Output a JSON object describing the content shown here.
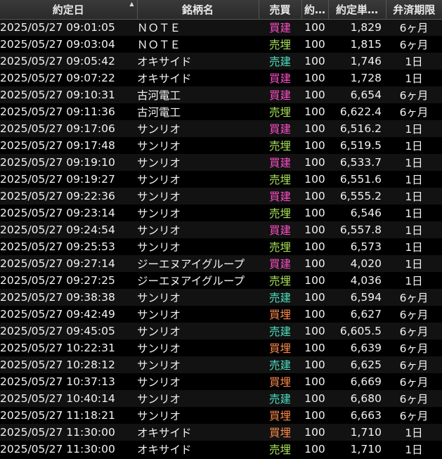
{
  "columns": [
    {
      "label": "約定日",
      "sorted": true
    },
    {
      "label": "銘柄名"
    },
    {
      "label": "売買"
    },
    {
      "label": "約…"
    },
    {
      "label": "約定単…"
    },
    {
      "label": "弁済期限"
    }
  ],
  "side_colors": {
    "買建": "#ff4fc8",
    "売埋": "#a8e05a",
    "売建": "#4fe0c0",
    "買埋": "#ff8a4a"
  },
  "rows": [
    {
      "datetime": "2025/05/27 09:01:05",
      "name": "ＮＯＴＥ",
      "side": "買建",
      "qty": "100",
      "price": "1,829",
      "term": "6ヶ月"
    },
    {
      "datetime": "2025/05/27 09:03:04",
      "name": "ＮＯＴＥ",
      "side": "売埋",
      "qty": "100",
      "price": "1,815",
      "term": "6ヶ月"
    },
    {
      "datetime": "2025/05/27 09:05:42",
      "name": "オキサイド",
      "side": "売建",
      "qty": "100",
      "price": "1,746",
      "term": "1日"
    },
    {
      "datetime": "2025/05/27 09:07:22",
      "name": "オキサイド",
      "side": "買建",
      "qty": "100",
      "price": "1,728",
      "term": "1日"
    },
    {
      "datetime": "2025/05/27 09:10:31",
      "name": "古河電工",
      "side": "買建",
      "qty": "100",
      "price": "6,654",
      "term": "6ヶ月"
    },
    {
      "datetime": "2025/05/27 09:11:36",
      "name": "古河電工",
      "side": "売埋",
      "qty": "100",
      "price": "6,622.4",
      "term": "6ヶ月"
    },
    {
      "datetime": "2025/05/27 09:17:06",
      "name": "サンリオ",
      "side": "買建",
      "qty": "100",
      "price": "6,516.2",
      "term": "1日"
    },
    {
      "datetime": "2025/05/27 09:17:48",
      "name": "サンリオ",
      "side": "売埋",
      "qty": "100",
      "price": "6,519.5",
      "term": "1日"
    },
    {
      "datetime": "2025/05/27 09:19:10",
      "name": "サンリオ",
      "side": "買建",
      "qty": "100",
      "price": "6,533.7",
      "term": "1日"
    },
    {
      "datetime": "2025/05/27 09:19:27",
      "name": "サンリオ",
      "side": "売埋",
      "qty": "100",
      "price": "6,551.6",
      "term": "1日"
    },
    {
      "datetime": "2025/05/27 09:22:36",
      "name": "サンリオ",
      "side": "買建",
      "qty": "100",
      "price": "6,555.2",
      "term": "1日"
    },
    {
      "datetime": "2025/05/27 09:23:14",
      "name": "サンリオ",
      "side": "売埋",
      "qty": "100",
      "price": "6,546",
      "term": "1日"
    },
    {
      "datetime": "2025/05/27 09:24:54",
      "name": "サンリオ",
      "side": "買建",
      "qty": "100",
      "price": "6,557.8",
      "term": "1日"
    },
    {
      "datetime": "2025/05/27 09:25:53",
      "name": "サンリオ",
      "side": "売埋",
      "qty": "100",
      "price": "6,573",
      "term": "1日"
    },
    {
      "datetime": "2025/05/27 09:27:14",
      "name": "ジーエヌアイグループ",
      "side": "買建",
      "qty": "100",
      "price": "4,020",
      "term": "1日"
    },
    {
      "datetime": "2025/05/27 09:27:25",
      "name": "ジーエヌアイグループ",
      "side": "売埋",
      "qty": "100",
      "price": "4,036",
      "term": "1日"
    },
    {
      "datetime": "2025/05/27 09:38:38",
      "name": "サンリオ",
      "side": "売建",
      "qty": "100",
      "price": "6,594",
      "term": "6ヶ月"
    },
    {
      "datetime": "2025/05/27 09:42:49",
      "name": "サンリオ",
      "side": "買埋",
      "qty": "100",
      "price": "6,627",
      "term": "6ヶ月"
    },
    {
      "datetime": "2025/05/27 09:45:05",
      "name": "サンリオ",
      "side": "売建",
      "qty": "100",
      "price": "6,605.5",
      "term": "6ヶ月"
    },
    {
      "datetime": "2025/05/27 10:22:31",
      "name": "サンリオ",
      "side": "買埋",
      "qty": "100",
      "price": "6,639",
      "term": "6ヶ月"
    },
    {
      "datetime": "2025/05/27 10:28:12",
      "name": "サンリオ",
      "side": "売建",
      "qty": "100",
      "price": "6,625",
      "term": "6ヶ月"
    },
    {
      "datetime": "2025/05/27 10:37:13",
      "name": "サンリオ",
      "side": "買埋",
      "qty": "100",
      "price": "6,669",
      "term": "6ヶ月"
    },
    {
      "datetime": "2025/05/27 10:40:14",
      "name": "サンリオ",
      "side": "売建",
      "qty": "100",
      "price": "6,680",
      "term": "6ヶ月"
    },
    {
      "datetime": "2025/05/27 11:18:21",
      "name": "サンリオ",
      "side": "買埋",
      "qty": "100",
      "price": "6,663",
      "term": "6ヶ月"
    },
    {
      "datetime": "2025/05/27 11:30:00",
      "name": "オキサイド",
      "side": "買埋",
      "qty": "100",
      "price": "1,710",
      "term": "1日"
    },
    {
      "datetime": "2025/05/27 11:30:00",
      "name": "オキサイド",
      "side": "売埋",
      "qty": "100",
      "price": "1,710",
      "term": "1日"
    }
  ]
}
